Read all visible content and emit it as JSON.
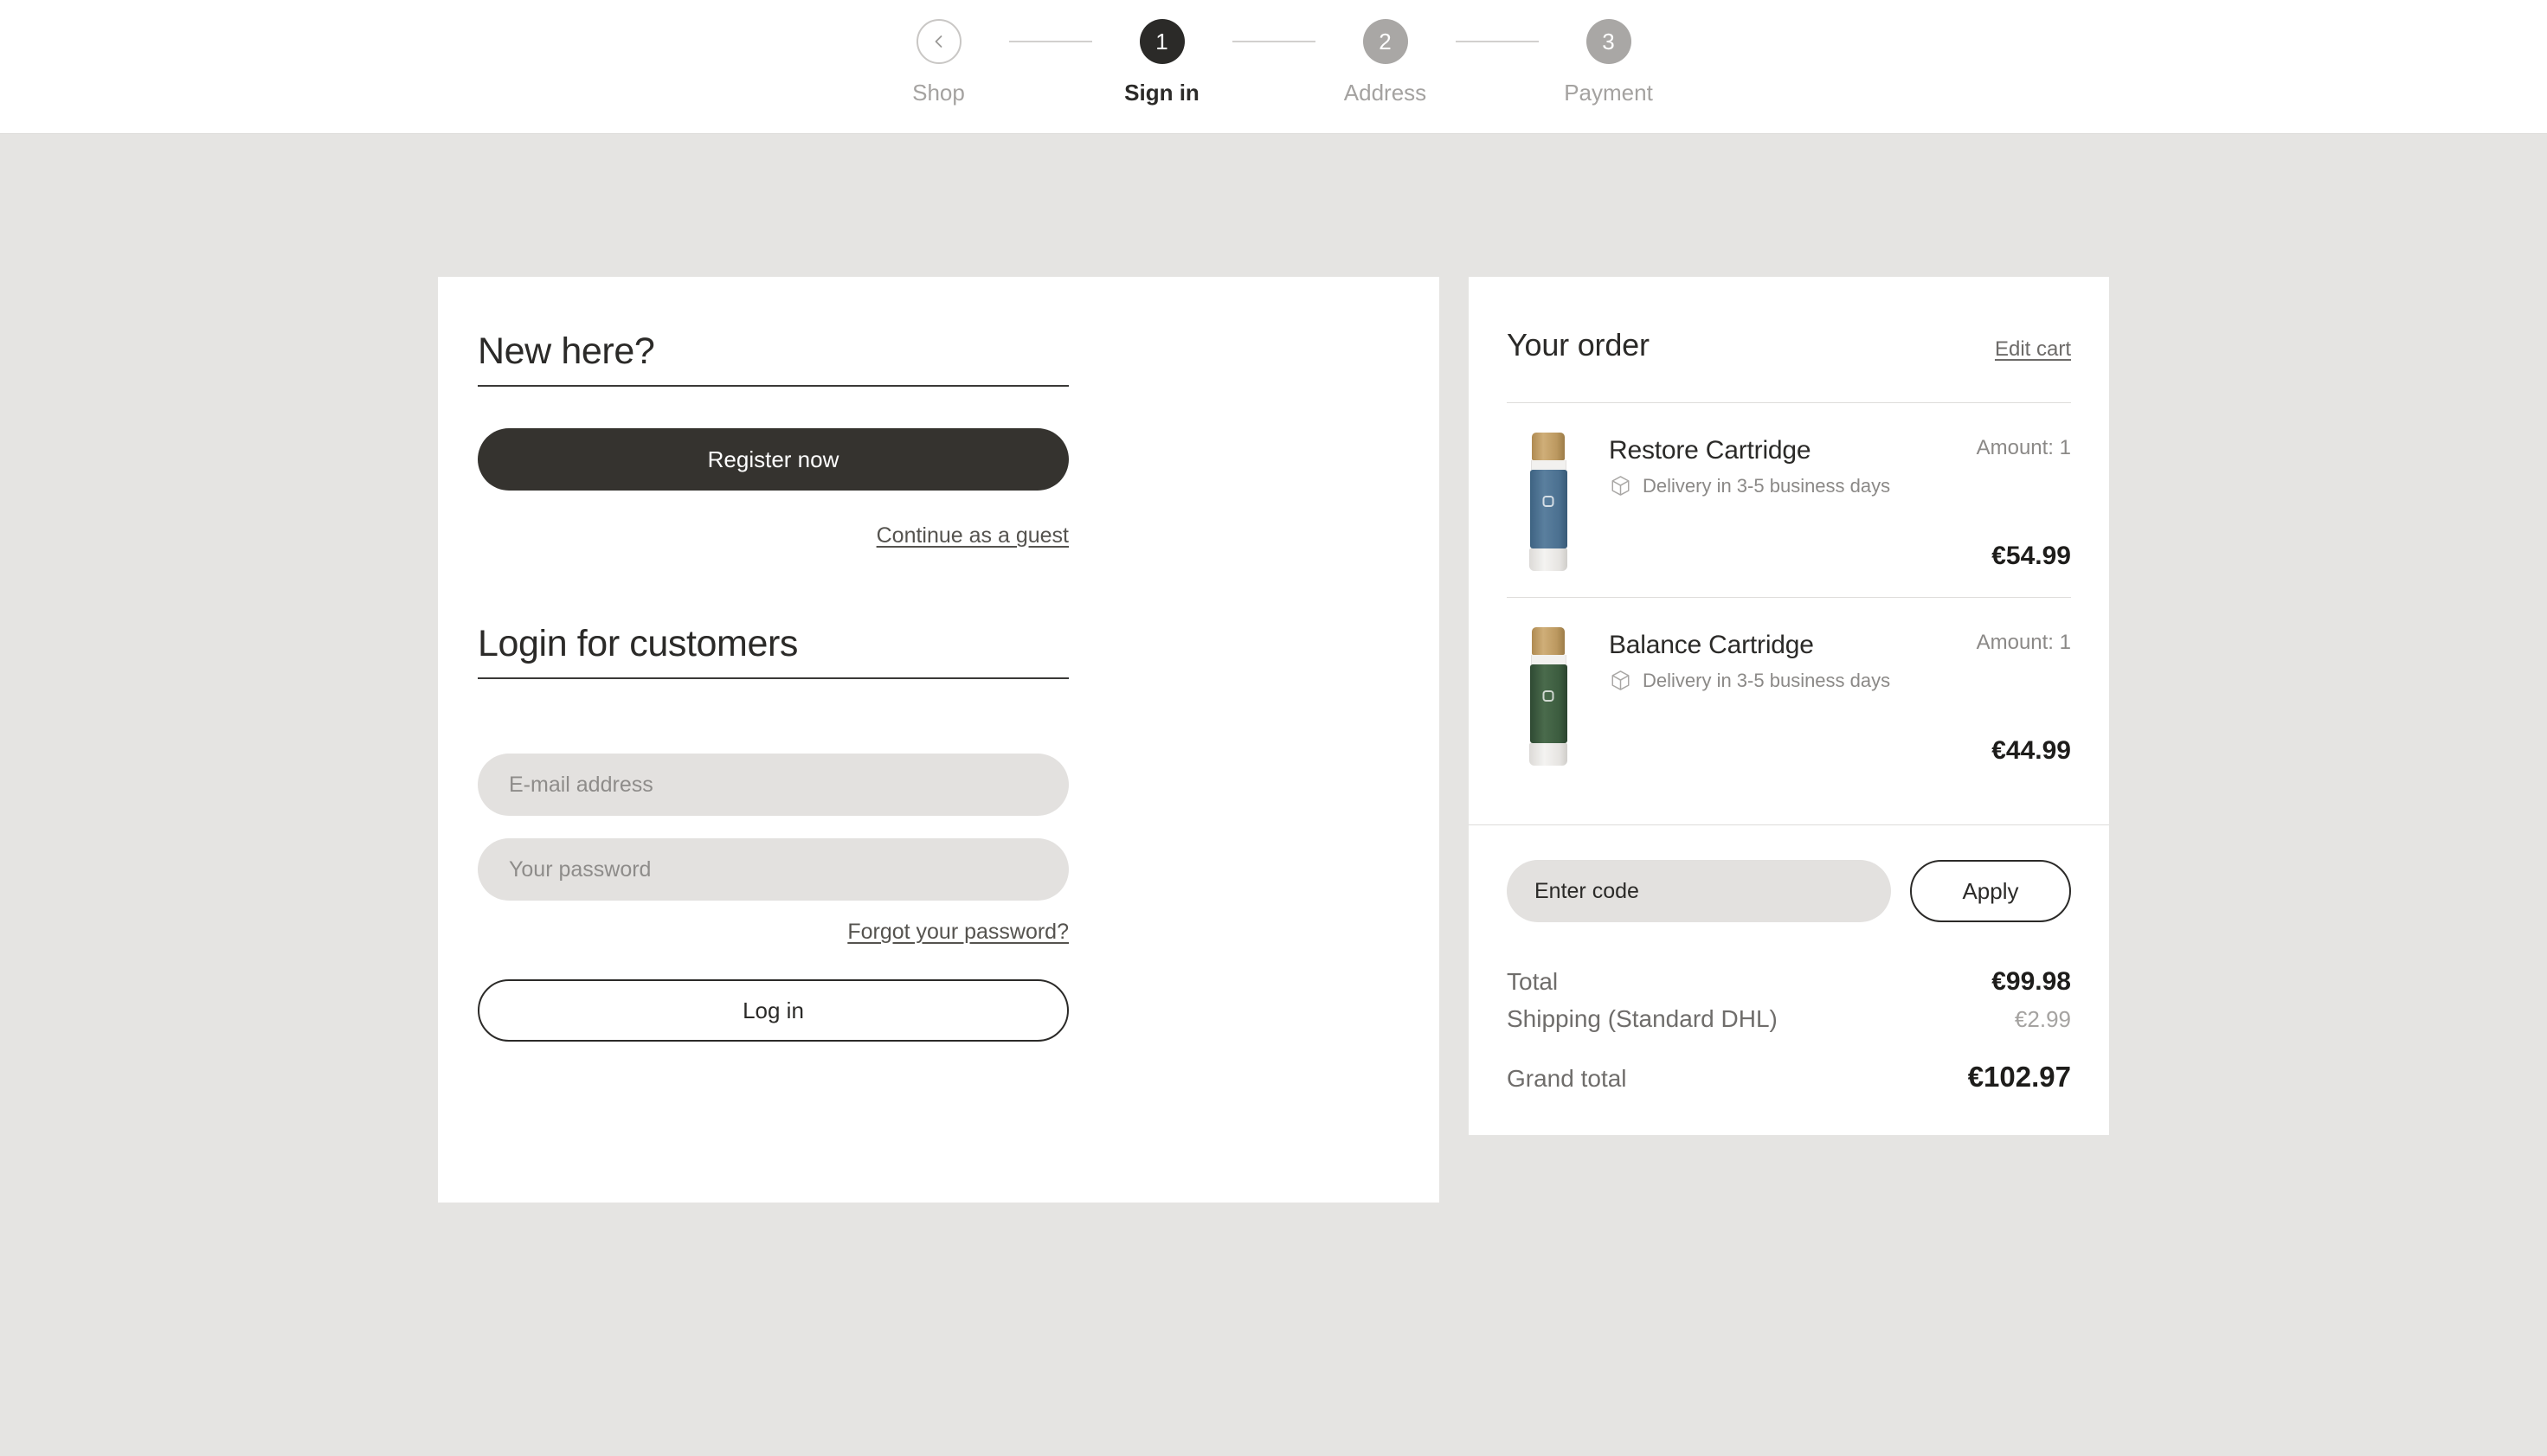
{
  "stepper": {
    "back_icon": "chevron-left-icon",
    "steps": [
      {
        "num": "",
        "label": "Shop",
        "state": "back"
      },
      {
        "num": "1",
        "label": "Sign in",
        "state": "active"
      },
      {
        "num": "2",
        "label": "Address",
        "state": "inactive"
      },
      {
        "num": "3",
        "label": "Payment",
        "state": "inactive"
      }
    ]
  },
  "new_customer": {
    "title": "New here?",
    "register_label": "Register now",
    "guest_label": "Continue as a guest"
  },
  "login": {
    "title": "Login for customers",
    "email_placeholder": "E-mail address",
    "email_value": "",
    "password_placeholder": "Your password",
    "password_value": "",
    "forgot_label": "Forgot your password?",
    "login_label": "Log in"
  },
  "order": {
    "title": "Your order",
    "edit_cart_label": "Edit cart",
    "delivery_icon": "package-icon",
    "items": [
      {
        "name": "Restore Cartridge",
        "delivery": "Delivery in 3-5 business days",
        "amount": "Amount: 1",
        "price": "€54.99",
        "color": "blue"
      },
      {
        "name": "Balance Cartridge",
        "delivery": "Delivery in 3-5 business days",
        "amount": "Amount: 1",
        "price": "€44.99",
        "color": "green"
      }
    ],
    "promo_placeholder": "Enter code",
    "promo_value": "",
    "apply_label": "Apply",
    "totals": {
      "total_label": "Total",
      "total_value": "€99.98",
      "shipping_label": "Shipping (Standard DHL)",
      "shipping_value": "€2.99",
      "grand_label": "Grand total",
      "grand_value": "€102.97"
    }
  },
  "colors": {
    "page_bg": "#e5e4e2",
    "card_bg": "#ffffff",
    "accent_dark": "#35332f",
    "text_primary": "#2b2a28",
    "text_muted": "#8b8987",
    "field_bg": "#e3e1df"
  }
}
